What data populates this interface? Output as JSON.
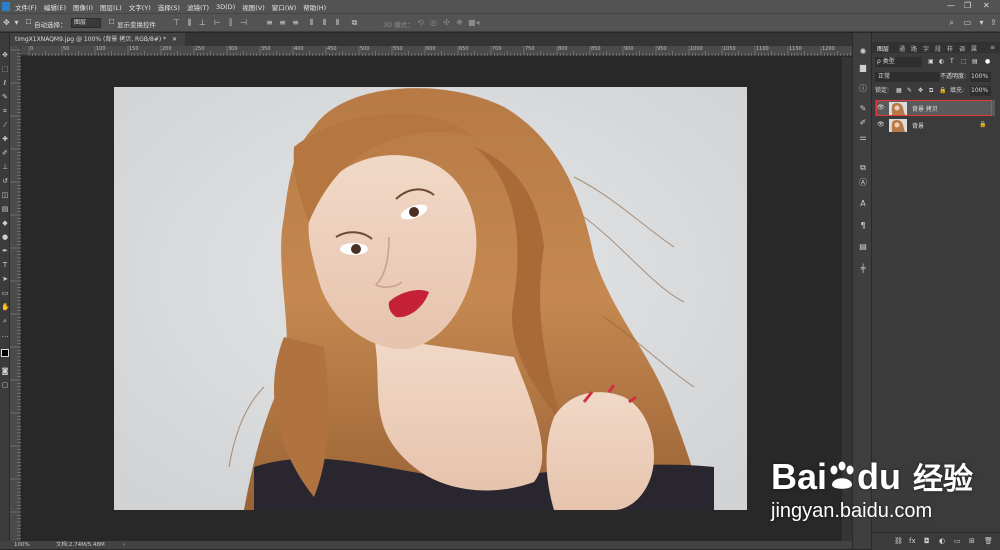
{
  "menubar": {
    "items": [
      "文件(F)",
      "编辑(E)",
      "图像(I)",
      "图层(L)",
      "文字(Y)",
      "选择(S)",
      "滤镜(T)",
      "3D(D)",
      "视图(V)",
      "窗口(W)",
      "帮助(H)"
    ]
  },
  "options": {
    "auto_select_label": "自动选择：",
    "auto_select_value": "图层",
    "show_transform_label": "显示变换控件",
    "mode_3d_label": "3D 模式："
  },
  "document": {
    "tab_title": "timgX1XNAQM9.jpg @ 100% (背景 拷贝, RGB/8#) *"
  },
  "ruler": {
    "h_ticks": [
      "0",
      "50",
      "100",
      "150",
      "200",
      "250",
      "300",
      "350",
      "400",
      "450",
      "500",
      "550",
      "600",
      "650",
      "700",
      "750",
      "800",
      "850",
      "900",
      "950",
      "1000",
      "1050",
      "1100",
      "1150",
      "1200"
    ]
  },
  "status": {
    "zoom": "100%",
    "doc_info": "文档:2.74M/5.48M"
  },
  "layers_panel": {
    "tabs": [
      "图层",
      "通",
      "路",
      "字",
      "段",
      "样",
      "调",
      "属"
    ],
    "filter_label": "ρ 类型",
    "blend_mode": "正常",
    "opacity_label": "不透明度:",
    "opacity_value": "100%",
    "lock_label": "锁定:",
    "fill_label": "填充:",
    "fill_value": "100%",
    "layers": [
      {
        "name": "背景 拷贝",
        "selected": true
      },
      {
        "name": "背景",
        "locked": true
      }
    ]
  },
  "watermark": {
    "brand": "Bai",
    "brand2": "du",
    "cn": "经验",
    "url": "jingyan.baidu.com"
  },
  "colors": {
    "selection_outline": "#e23a3a",
    "ps_blue": "#2a7fc8",
    "baidu_red": "#ffffff"
  }
}
